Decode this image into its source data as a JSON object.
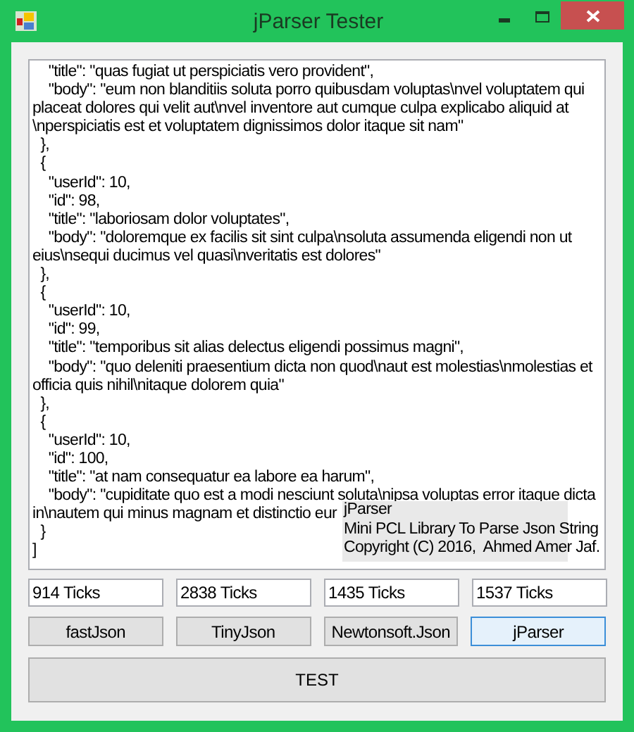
{
  "window": {
    "title": "jParser Tester"
  },
  "output_text": {
    "lines": [
      "    \"title\": \"quas fugiat ut perspiciatis vero provident\",",
      "    \"body\": \"eum non blanditiis soluta porro quibusdam voluptas\\nvel voluptatem qui",
      "placeat dolores qui velit aut\\nvel inventore aut cumque culpa explicabo aliquid at",
      "\\nperspiciatis est et voluptatem dignissimos dolor itaque sit nam\"",
      "  },",
      "  {",
      "    \"userId\": 10,",
      "    \"id\": 98,",
      "    \"title\": \"laboriosam dolor voluptates\",",
      "    \"body\": \"doloremque ex facilis sit sint culpa\\nsoluta assumenda eligendi non ut",
      "eius\\nsequi ducimus vel quasi\\nveritatis est dolores\"",
      "  },",
      "  {",
      "    \"userId\": 10,",
      "    \"id\": 99,",
      "    \"title\": \"temporibus sit alias delectus eligendi possimus magni\",",
      "    \"body\": \"quo deleniti praesentium dicta non quod\\naut est molestias\\nmolestias et",
      "officia quis nihil\\nitaque dolorem quia\"",
      "  },",
      "  {",
      "    \"userId\": 10,",
      "    \"id\": 100,",
      "    \"title\": \"at nam consequatur ea labore ea harum\",",
      "    \"body\": \"cupiditate quo est a modi nesciunt soluta\\nipsa voluptas error itaque dicta",
      "in\\nautem qui minus magnam et distinctio eur",
      "  }",
      "]"
    ]
  },
  "tooltip": {
    "lines": [
      "jParser",
      "Mini PCL Library To Parse Json String",
      "Copyright (C) 2016,  Ahmed Amer Jaf."
    ]
  },
  "tick_fields": [
    {
      "value": "914 Ticks"
    },
    {
      "value": "2838 Ticks"
    },
    {
      "value": "1435 Ticks"
    },
    {
      "value": "1537 Ticks"
    }
  ],
  "parser_buttons": [
    {
      "label": "fastJson",
      "focused": false
    },
    {
      "label": "TinyJson",
      "focused": false
    },
    {
      "label": "Newtonsoft.Json",
      "focused": false
    },
    {
      "label": "jParser",
      "focused": true
    }
  ],
  "test_button": {
    "label": "TEST"
  }
}
